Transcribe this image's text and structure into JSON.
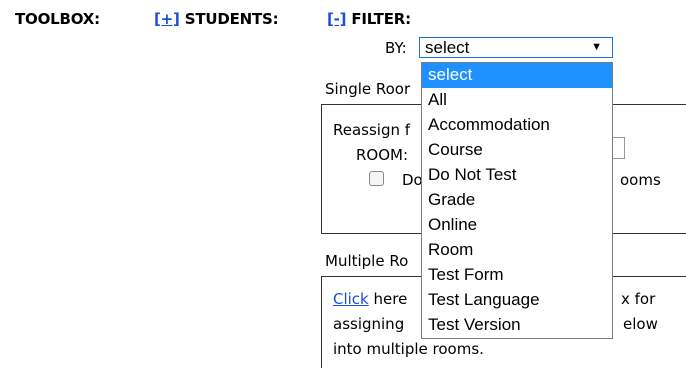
{
  "header": {
    "toolbox_label": "TOOLBOX:",
    "students_toggle": "[+]",
    "students_label": "STUDENTS:",
    "filter_toggle": "[-]",
    "filter_label": "FILTER:"
  },
  "filter": {
    "by_label": "BY:",
    "selected_value": "select",
    "options": [
      "select",
      "All",
      "Accommodation",
      "Course",
      "Do Not Test",
      "Grade",
      "Online",
      "Room",
      "Test Form",
      "Test Language",
      "Test Version"
    ]
  },
  "single_room": {
    "label": "Single Roor",
    "reassign_text": "Reassign f",
    "room_label": "ROOM:",
    "checkbox_prefix": "Do",
    "checkbox_suffix": "ooms"
  },
  "multiple_rooms": {
    "label": "Multiple Ro",
    "link_text": "Click",
    "line1_after_link": " here",
    "line1_suffix": "x for",
    "line2_prefix": "assigning",
    "line2_suffix": "elow",
    "line3": "into multiple rooms."
  },
  "colors": {
    "link": "#1a4fd6",
    "selected_option_bg": "#1e90ff",
    "select_border": "#1a73d9"
  }
}
